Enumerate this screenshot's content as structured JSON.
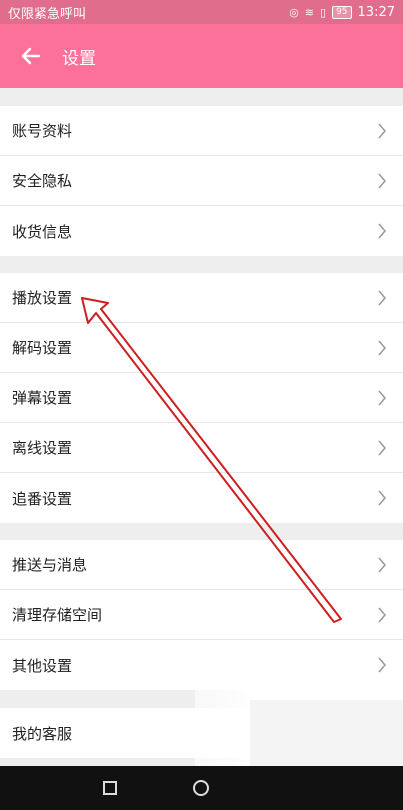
{
  "status": {
    "left_text": "仅限紧急呼叫",
    "battery": "95",
    "time": "13:27"
  },
  "header": {
    "title": "设置",
    "back_icon": "arrow-left-icon"
  },
  "sections": [
    {
      "items": [
        "账号资料",
        "安全隐私",
        "收货信息"
      ]
    },
    {
      "items": [
        "播放设置",
        "解码设置",
        "弹幕设置",
        "离线设置",
        "追番设置"
      ]
    },
    {
      "items": [
        "推送与消息",
        "清理存储空间",
        "其他设置"
      ]
    },
    {
      "items": [
        "我的客服"
      ]
    }
  ],
  "colors": {
    "status_bar": "#e06d8b",
    "app_bar": "#fb7199",
    "annotation_arrow": "#cc1f1f"
  }
}
